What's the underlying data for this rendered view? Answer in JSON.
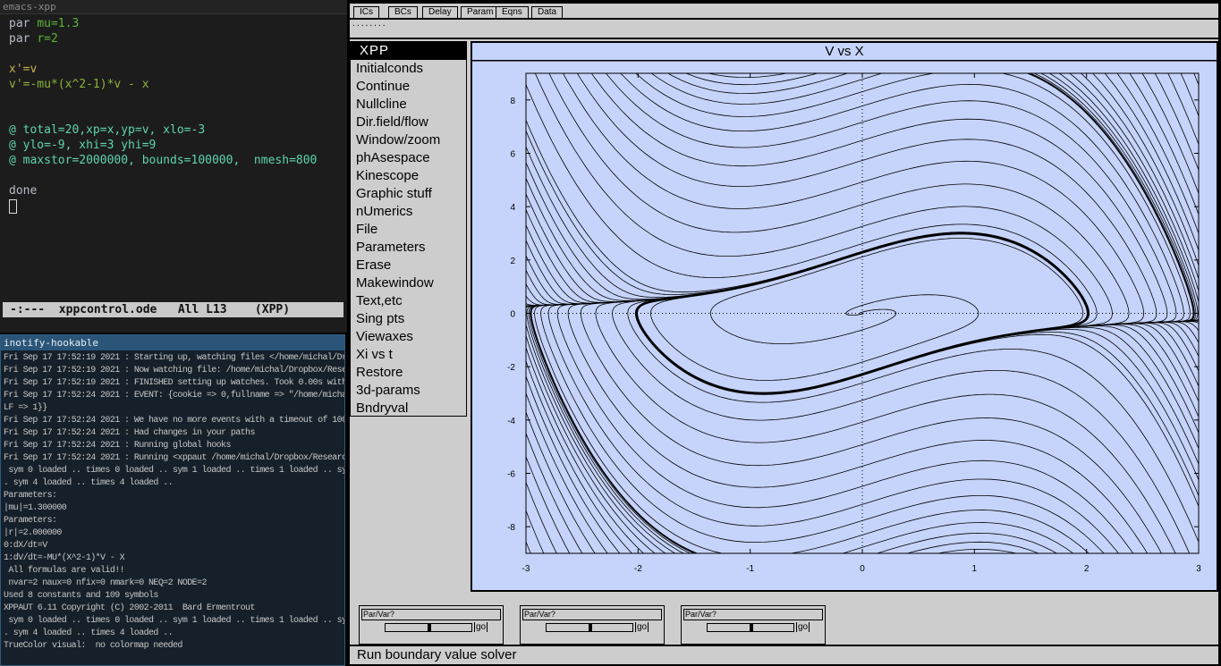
{
  "emacs": {
    "title": "emacs-xpp",
    "lines": [
      {
        "kw": "par ",
        "val": "mu=1.3"
      },
      {
        "kw": "par ",
        "val": "r=2"
      },
      {
        "eq": "x'=v"
      },
      {
        "eq": "v'=-mu*(x^2-1)*v - x"
      },
      {
        "at": "@ total=20,xp=x,yp=v, xlo=-3"
      },
      {
        "at": "@ ylo=-9, xhi=3 yhi=9"
      },
      {
        "at": "@ maxstor=2000000, bounds=100000,  nmesh=800"
      },
      {
        "kw": "done"
      }
    ],
    "modeline": "-:---  xppcontrol.ode   All L13    (XPP)"
  },
  "inotify": {
    "title": "inotify-hookable",
    "log": [
      "Fri Sep 17 17:52:19 2021 : Starting up, watching files </home/michal/Dropbo",
      "Fri Sep 17 17:52:19 2021 : Now watching file: /home/michal/Dropbox/Research",
      "Fri Sep 17 17:52:19 2021 : FINISHED setting up watches. Took 0.00s with 1 w",
      "Fri Sep 17 17:52:24 2021 : EVENT: {cookie => 0,fullname => \"/home/michal/Dr",
      "LF => 1}}",
      "Fri Sep 17 17:52:24 2021 : We have no more events with a timeout of 100 ms",
      "Fri Sep 17 17:52:24 2021 : Had changes in your paths",
      "Fri Sep 17 17:52:24 2021 : Running global hooks",
      "Fri Sep 17 17:52:24 2021 : Running <xppaut /home/michal/Dropbox/Research/xp",
      " sym 0 loaded .. times 0 loaded .. sym 1 loaded .. times 1 loaded .. sym 2",
      ". sym 4 loaded .. times 4 loaded ..",
      "Parameters:",
      "|mu|=1.300000",
      "Parameters:",
      "|r|=2.000000",
      "0:dX/dt=V",
      "1:dV/dt=-MU*(X^2-1)*V - X",
      " All formulas are valid!!",
      " nvar=2 naux=0 nfix=0 nmark=0 NEQ=2 NODE=2",
      "Used 8 constants and 109 symbols",
      "XPPAUT 6.11 Copyright (C) 2002-2011  Bard Ermentrout",
      " sym 0 loaded .. times 0 loaded .. sym 1 loaded .. times 1 loaded .. sym 2",
      ". sym 4 loaded .. times 4 loaded ..",
      "TrueColor visual:  no colormap needed"
    ]
  },
  "xpp": {
    "top_buttons": [
      "ICs",
      "BCs",
      "Delay",
      "Param",
      "Eqns",
      "Data"
    ],
    "command_line": "........",
    "menu": [
      "XPP",
      "Initialconds",
      "Continue",
      "Nullcline",
      "Dir.field/flow",
      "Window/zoom",
      "phAsespace",
      "Kinescope",
      "Graphic stuff",
      "nUmerics",
      "File",
      "Parameters",
      "Erase",
      "Makewindow",
      "Text,etc",
      "Sing pts",
      "Viewaxes",
      "Xi vs t",
      "Restore",
      "3d-params",
      "Bndryval"
    ],
    "plot": {
      "title": "V vs X",
      "mu": 1.3,
      "xlim": [
        -3,
        3
      ],
      "ylim": [
        -9,
        9
      ],
      "xticks": [
        "-3",
        "-2",
        "-1",
        "0",
        "1",
        "2",
        "3"
      ],
      "yticks": [
        "8",
        "6",
        "4",
        "2",
        "0",
        "-2",
        "-4",
        "-6",
        "-8"
      ],
      "background": "#c6d4fb"
    },
    "sliders": [
      {
        "label": "Par/Var?",
        "go": "go",
        "position": 0.5
      },
      {
        "label": "Par/Var?",
        "go": "go",
        "position": 0.5
      },
      {
        "label": "Par/Var?",
        "go": "go",
        "position": 0.5
      }
    ],
    "status": "Run boundary value solver"
  }
}
